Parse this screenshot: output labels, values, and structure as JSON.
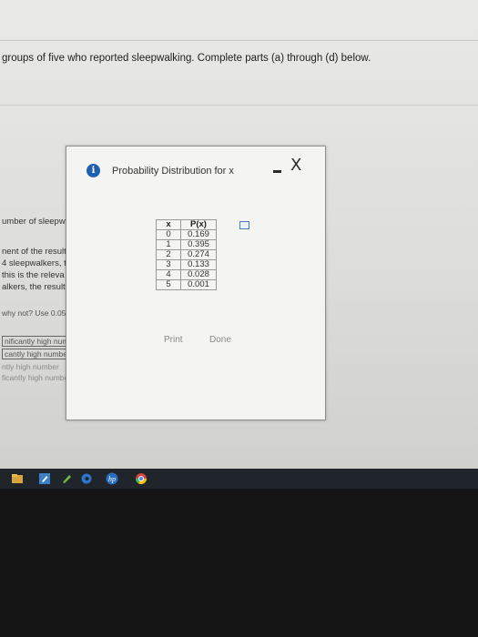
{
  "question": {
    "prompt": "groups of five who reported sleepwalking. Complete parts (a) through (d) below."
  },
  "background_fragments": {
    "line1": "umber of sleepw",
    "line1_tail": ")?",
    "line2": "nent of the result",
    "line3": "4 sleepwalkers, t",
    "line4": "this is the releva",
    "line5": "alkers, the result",
    "line6": "why not? Use 0.05",
    "options": [
      "nificantly high num",
      "cantly high numbe",
      "ntly high number",
      "ficantly high number"
    ]
  },
  "dialog": {
    "title": "Probability Distribution for x",
    "close_symbol": "X",
    "table": {
      "headers": [
        "x",
        "P(x)"
      ],
      "rows": [
        [
          "0",
          "0.169"
        ],
        [
          "1",
          "0.395"
        ],
        [
          "2",
          "0.274"
        ],
        [
          "3",
          "0.133"
        ],
        [
          "4",
          "0.028"
        ],
        [
          "5",
          "0.001"
        ]
      ]
    },
    "print_label": "Print",
    "done_label": "Done"
  },
  "taskbar": {
    "icons": [
      "file-explorer-icon",
      "edit-icon",
      "edge-icon",
      "hp-icon",
      "chrome-icon"
    ],
    "hp_label": "hp"
  },
  "colors": {
    "info_icon": "#1f5fb0",
    "taskbar": "#20242b"
  }
}
